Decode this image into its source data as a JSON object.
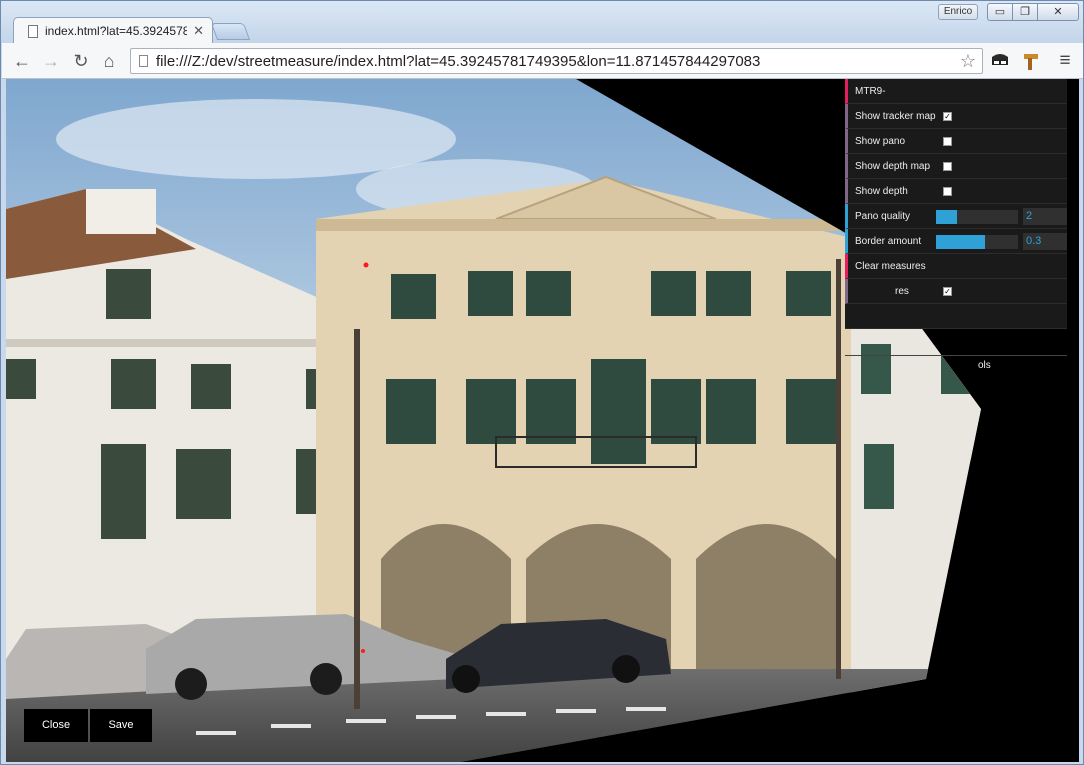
{
  "window": {
    "user": "Enrico",
    "min_glyph": "▭",
    "max_glyph": "❐",
    "close_glyph": "✕"
  },
  "tab": {
    "title": "index.html?lat=45.3924578",
    "close_glyph": "✕"
  },
  "toolbar": {
    "back_glyph": "←",
    "forward_glyph": "→",
    "reload_glyph": "↻",
    "home_glyph": "⌂",
    "url": "file:///Z:/dev/streetmeasure/index.html?lat=45.39245781749395&lon=11.871457844297083",
    "star_glyph": "☆",
    "menu_glyph": "≡",
    "icons": [
      "back-icon",
      "forward-icon",
      "reload-icon",
      "home-icon",
      "star-icon",
      "mask-extension-icon",
      "hammer-extension-icon",
      "menu-icon"
    ]
  },
  "gui": {
    "title": "MTR9-",
    "show_tracker_map": {
      "label": "Show tracker map",
      "checked": true
    },
    "show_pano": {
      "label": "Show pano",
      "checked": false
    },
    "show_depth_map": {
      "label": "Show depth map",
      "checked": false
    },
    "show_depth": {
      "label": "Show depth",
      "checked": false
    },
    "pano_quality": {
      "label": "Pano quality",
      "value": "2",
      "fraction": 0.25
    },
    "border_amount": {
      "label": "Border amount",
      "value": "0.3",
      "fraction": 0.6
    },
    "clear_measures": {
      "label": "Clear measures"
    },
    "show_measures": {
      "label": "res",
      "checked": true
    },
    "close_controls": "ols",
    "check_glyph": "✓"
  },
  "buttons": {
    "close": "Close",
    "save": "Save"
  },
  "colors": {
    "gui_accent_blue": "#2fa1d6",
    "gui_accent_red": "#e61d5f",
    "sky": "#8fb3d6",
    "facade": "#e4d3b3"
  }
}
